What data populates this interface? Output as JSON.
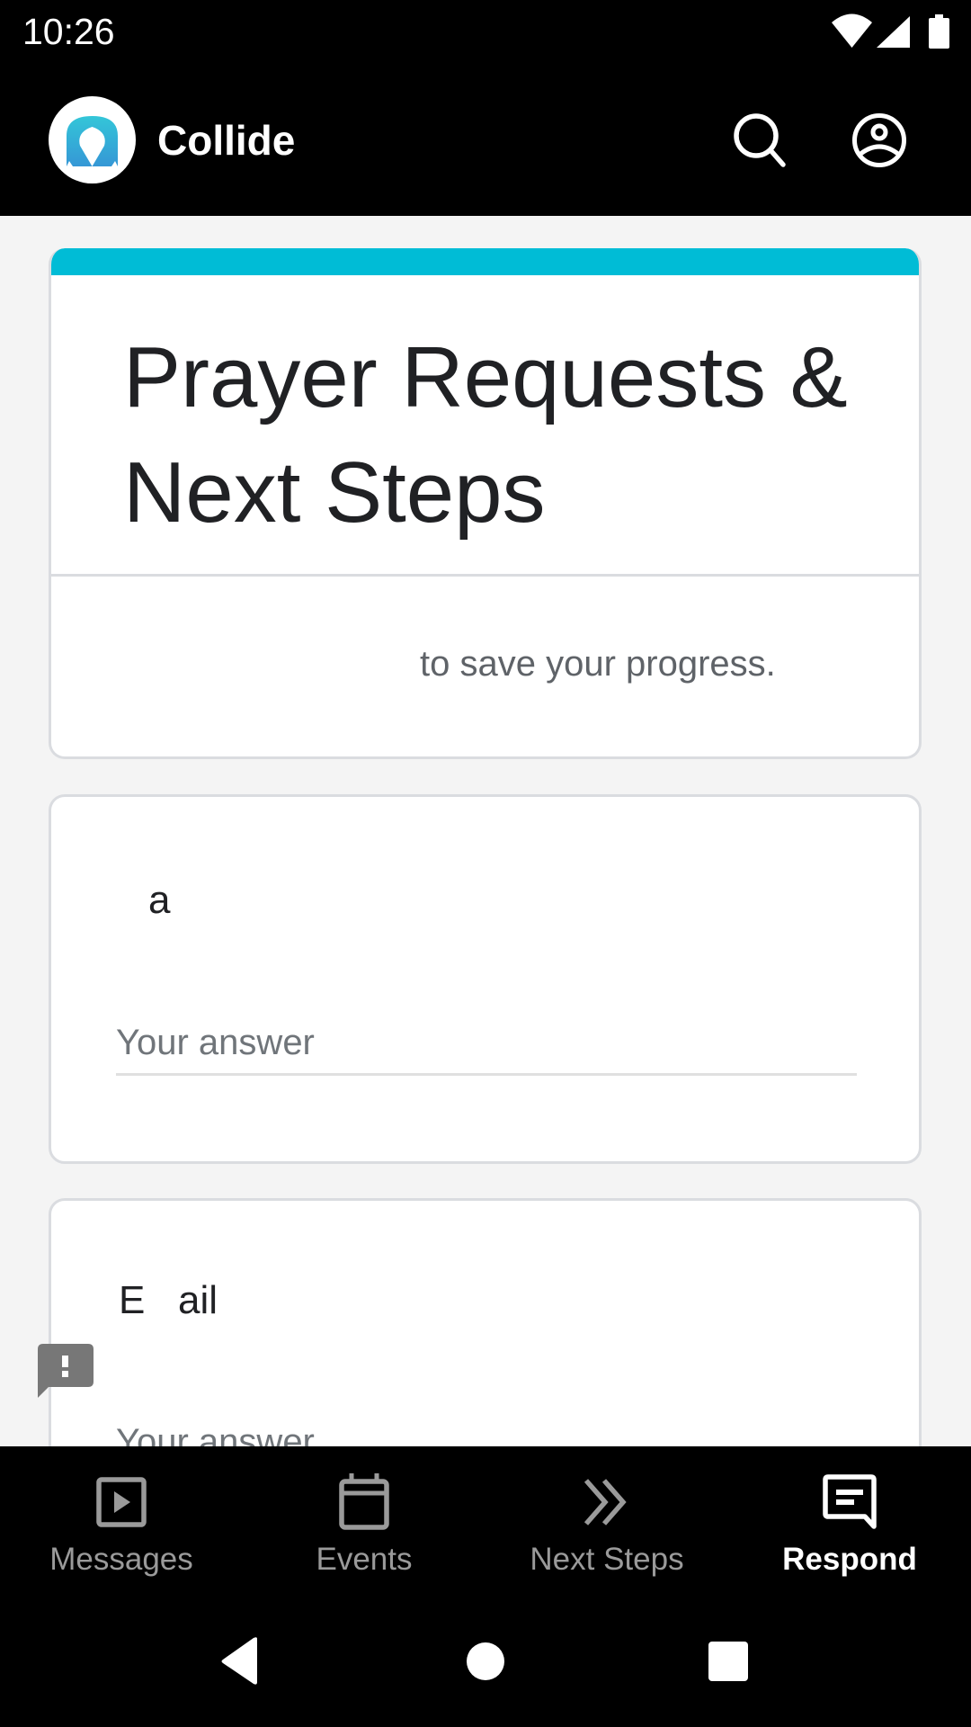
{
  "status_bar": {
    "time": "10:26",
    "icons": [
      "wifi-icon",
      "cell-signal-icon",
      "battery-icon"
    ]
  },
  "app_bar": {
    "title": "Collide",
    "logo": "collide-logo",
    "actions": [
      {
        "name": "search",
        "icon": "search-icon"
      },
      {
        "name": "account",
        "icon": "account-circle-icon"
      }
    ]
  },
  "form": {
    "accent_color": "#00bcd6",
    "title": "Prayer Requests & Next Steps",
    "progress_note": "to save your progress.",
    "questions": [
      {
        "label": "a",
        "placeholder": "Your answer",
        "value": ""
      },
      {
        "label": "E   ail",
        "placeholder": "Your answer",
        "value": ""
      }
    ]
  },
  "feedback": {
    "icon": "feedback-icon"
  },
  "bottom_nav": {
    "items": [
      {
        "label": "Messages",
        "icon": "play-box-icon",
        "active": false
      },
      {
        "label": "Events",
        "icon": "calendar-icon",
        "active": false
      },
      {
        "label": "Next Steps",
        "icon": "double-chevron-right-icon",
        "active": false
      },
      {
        "label": "Respond",
        "icon": "message-text-icon",
        "active": true
      }
    ]
  },
  "system_nav": {
    "buttons": [
      "back",
      "home",
      "recents"
    ]
  }
}
